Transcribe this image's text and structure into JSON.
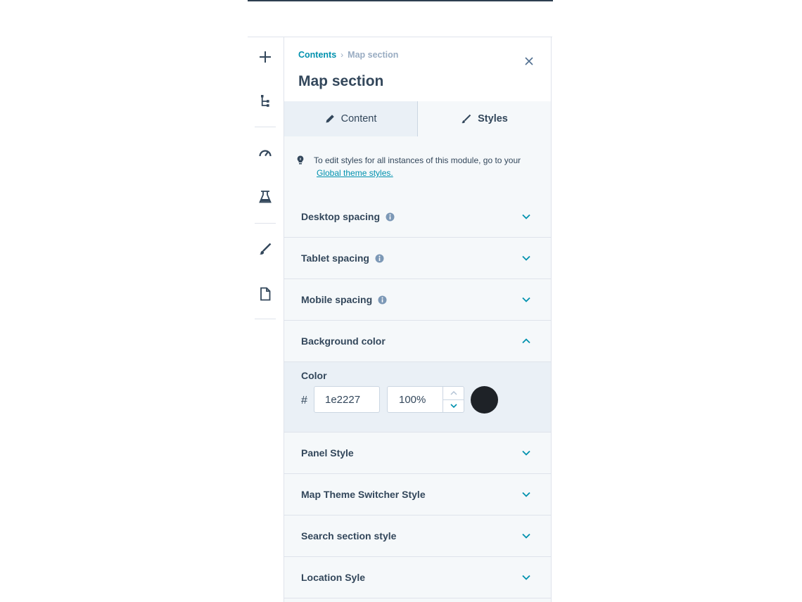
{
  "breadcrumb": {
    "parent": "Contents",
    "separator": "›",
    "current": "Map section"
  },
  "panel_title": "Map section",
  "tabs": [
    {
      "label": "Content",
      "icon": "pencil-icon",
      "active": false
    },
    {
      "label": "Styles",
      "icon": "brush-icon",
      "active": true
    }
  ],
  "notice": {
    "text": "To edit styles for all instances of this module, go to your",
    "link_text": "Global theme styles."
  },
  "accordions": [
    {
      "label": "Desktop spacing",
      "info": true,
      "expanded": false
    },
    {
      "label": "Tablet spacing",
      "info": true,
      "expanded": false
    },
    {
      "label": "Mobile spacing",
      "info": true,
      "expanded": false
    },
    {
      "label": "Background color",
      "info": false,
      "expanded": true
    },
    {
      "label": "Panel Style",
      "info": false,
      "expanded": false
    },
    {
      "label": "Map Theme Switcher Style",
      "info": false,
      "expanded": false
    },
    {
      "label": "Search section style",
      "info": false,
      "expanded": false
    },
    {
      "label": "Location Syle",
      "info": false,
      "expanded": false
    }
  ],
  "background_color": {
    "label": "Color",
    "hash": "#",
    "hex_value": "1e2227",
    "opacity_value": "100%",
    "swatch_color": "#1e2227"
  },
  "rail_icons": [
    "plus-icon",
    "tree-icon",
    "gauge-icon",
    "flask-icon",
    "brush-icon",
    "document-icon"
  ],
  "colors": {
    "accent": "#0091ae",
    "text": "#33475b",
    "muted": "#99acc2",
    "panel_bg": "#f5f8fa",
    "expanded_bg": "#eaf0f6"
  }
}
